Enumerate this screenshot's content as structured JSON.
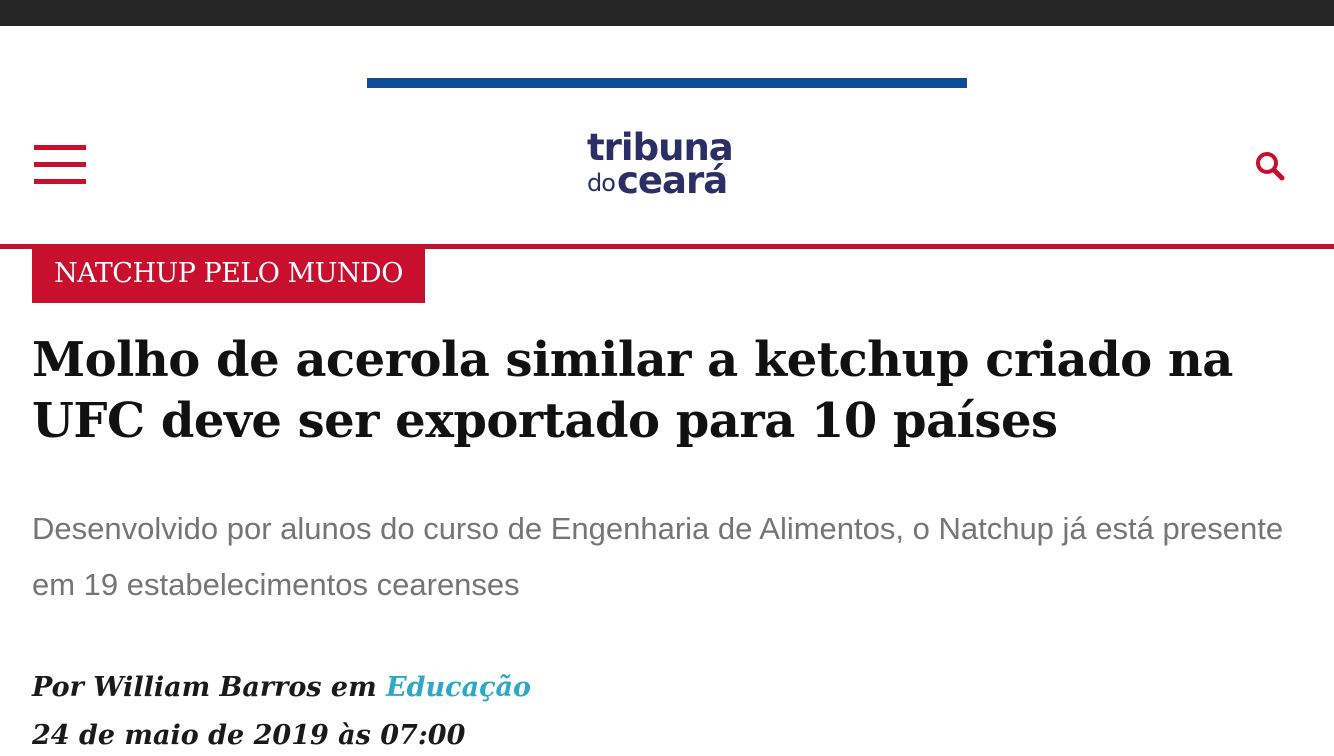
{
  "header": {
    "logo_line1": "tribuna",
    "logo_line2_small": "do",
    "logo_line2_big": "ceará",
    "accent_color": "#c8102e",
    "logo_color": "#2b2e67",
    "ad_bar_color": "#0f4c97"
  },
  "icons": {
    "menu": "hamburger-menu-icon",
    "search": "search-icon"
  },
  "article": {
    "category": "NATCHUP PELO MUNDO",
    "headline": "Molho de acerola similar a ketchup criado na UFC deve ser exportado para 10 países",
    "subtitle": "Desenvolvido por alunos do curso de Engenharia de Alimentos, o Natchup já está presente em 19 estabelecimentos cearenses",
    "byline_prefix": "Por William Barros em ",
    "section": "Educação",
    "section_color": "#2fa8c8",
    "date": "24 de maio de 2019 às 07:00"
  }
}
